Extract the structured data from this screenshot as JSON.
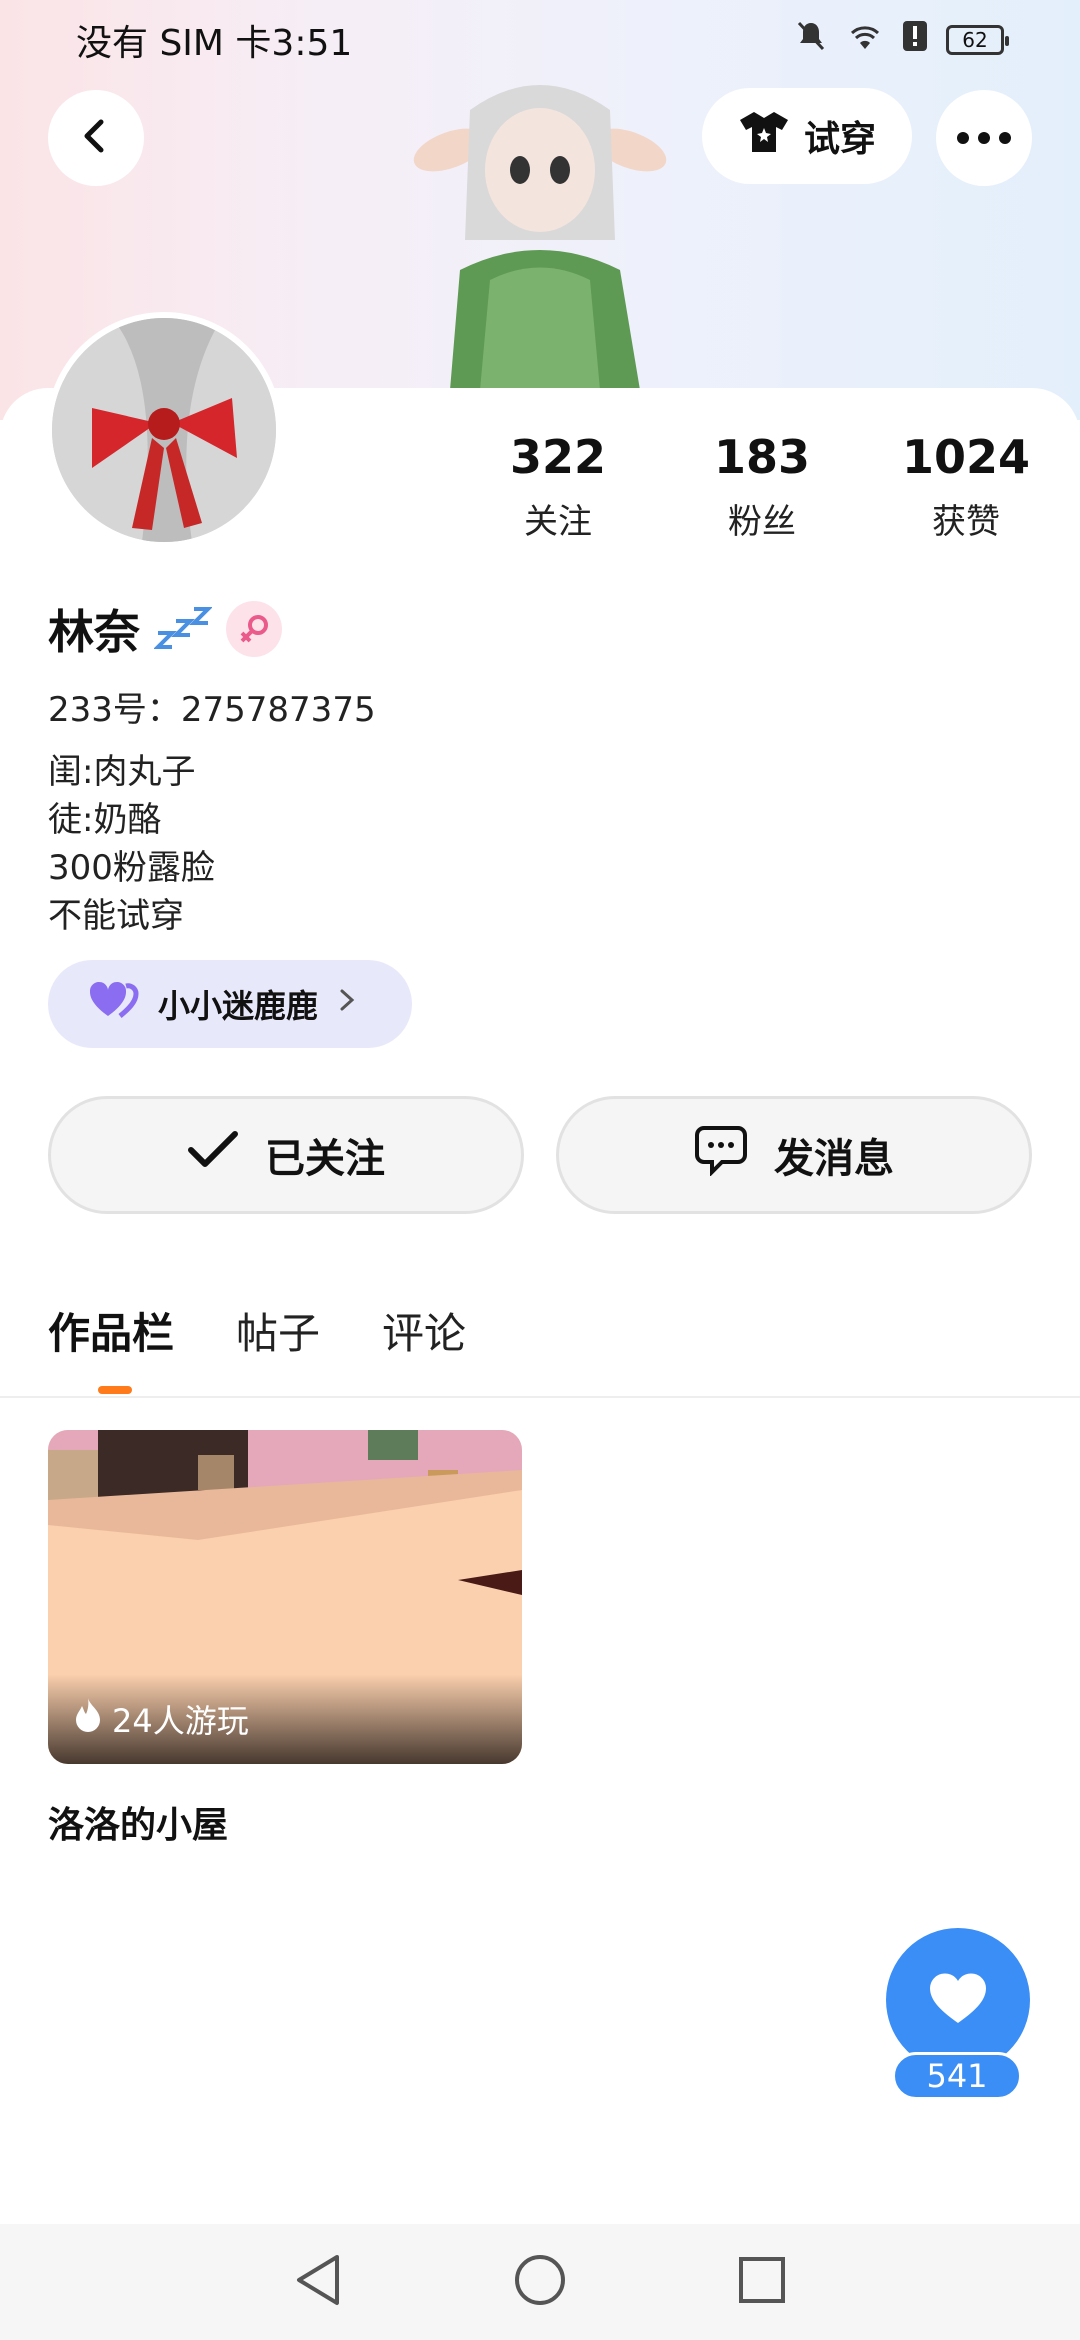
{
  "status_bar": {
    "carrier_time": "没有 SIM 卡3:51",
    "battery": "62",
    "icons": [
      "mute-icon",
      "wifi-icon",
      "alert-icon",
      "battery-icon"
    ]
  },
  "header": {
    "tryon_label": "试穿",
    "icons": [
      "back-icon",
      "shirt-icon",
      "more-icon"
    ]
  },
  "stats": [
    {
      "value": "322",
      "label": "关注"
    },
    {
      "value": "183",
      "label": "粉丝"
    },
    {
      "value": "1024",
      "label": "获赞"
    }
  ],
  "profile": {
    "name": "林奈",
    "uid": "233号：275787375",
    "bio": [
      "闺:肉丸子",
      "徒:奶酪",
      "300粉露脸",
      "不能试穿"
    ],
    "group_label": "小小迷鹿鹿"
  },
  "actions": {
    "follow_label": "已关注",
    "message_label": "发消息"
  },
  "tabs": [
    {
      "label": "作品栏",
      "active": true
    },
    {
      "label": "帖子",
      "active": false
    },
    {
      "label": "评论",
      "active": false
    }
  ],
  "works": [
    {
      "title": "洛洛的小屋",
      "plays": "24人游玩"
    }
  ],
  "like": {
    "count": "541"
  },
  "colors": {
    "accent": "#3a8ef6",
    "tab_indicator": "#ff7a1a",
    "group_pill": "#e8e8fb"
  }
}
